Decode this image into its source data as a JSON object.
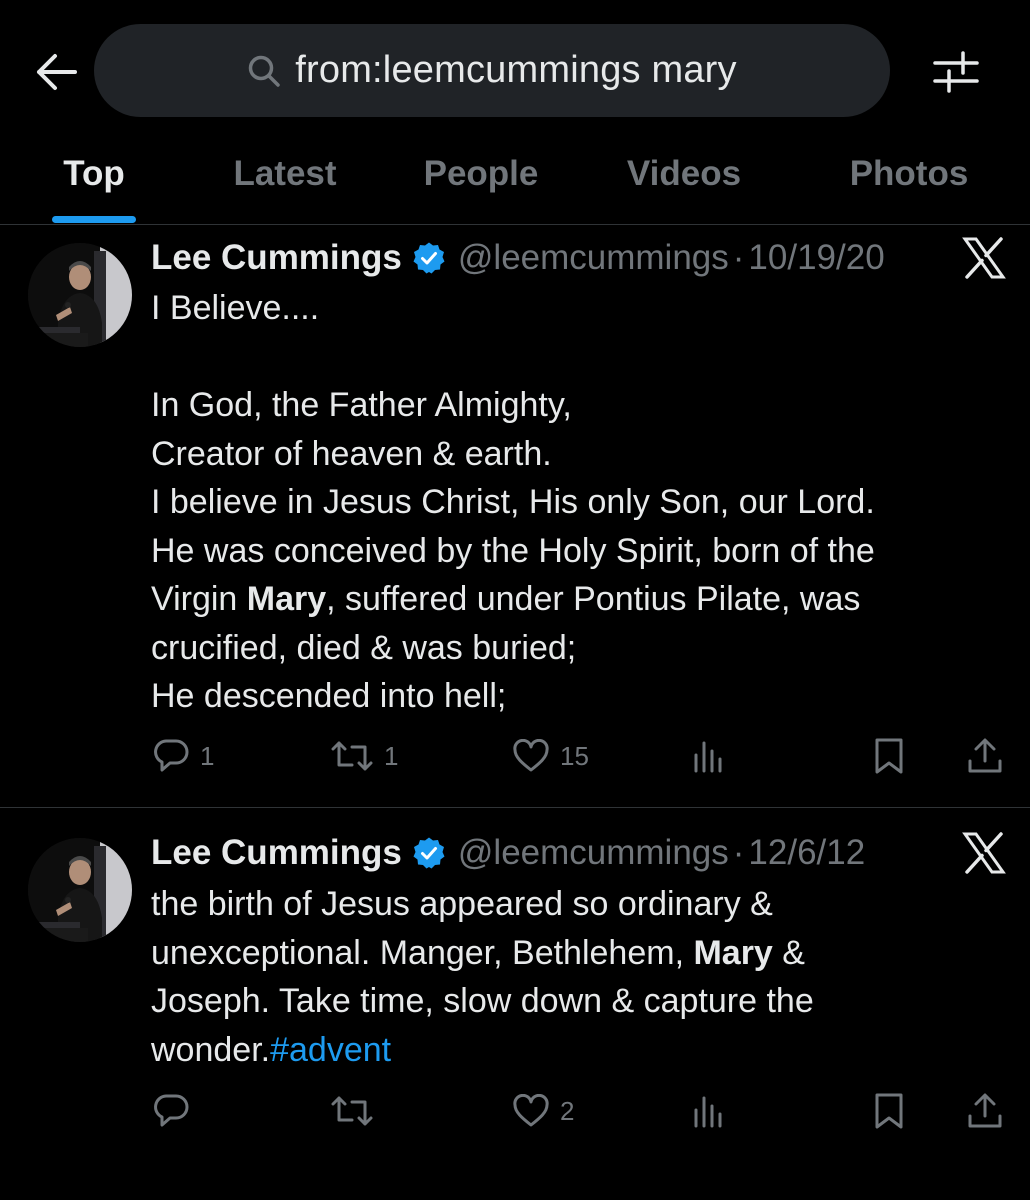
{
  "search": {
    "query": "from:leemcummings mary"
  },
  "tabs": [
    {
      "label": "Top",
      "active": true
    },
    {
      "label": "Latest",
      "active": false
    },
    {
      "label": "People",
      "active": false
    },
    {
      "label": "Videos",
      "active": false
    },
    {
      "label": "Photos",
      "active": false
    }
  ],
  "colors": {
    "background": "#000000",
    "accent": "#1d9bf0",
    "muted": "#71767b",
    "text": "#e7e9ea",
    "search_bg": "#202327"
  },
  "tweets": [
    {
      "author": "Lee Cummings",
      "handle": "@leemcummings",
      "separator": "·",
      "date": "10/19/20",
      "body": [
        {
          "text": "I Believe....\n\nIn God, the Father Almighty,\nCreator of heaven & earth.\nI believe in Jesus Christ, His only Son, our Lord.\nHe was conceived by the Holy Spirit, born of the\nVirgin "
        },
        {
          "text": "Mary",
          "style": "bold"
        },
        {
          "text": ", suffered under Pontius Pilate, was\ncrucified, died & was buried;\nHe descended into hell;"
        }
      ],
      "replies": "1",
      "reposts": "1",
      "likes": "15",
      "icons": [
        "reply-icon",
        "repost-icon",
        "like-icon",
        "views-icon",
        "bookmark-icon",
        "share-icon"
      ]
    },
    {
      "author": "Lee Cummings",
      "handle": "@leemcummings",
      "separator": "·",
      "date": "12/6/12",
      "body": [
        {
          "text": "the birth of Jesus appeared so ordinary &\nunexceptional. Manger, Bethlehem, "
        },
        {
          "text": "Mary",
          "style": "bold"
        },
        {
          "text": " &\nJoseph. Take time, slow down & capture the\nwonder."
        },
        {
          "text": "#advent",
          "style": "hashtag"
        }
      ],
      "replies": "",
      "reposts": "",
      "likes": "2",
      "icons": [
        "reply-icon",
        "repost-icon",
        "like-icon",
        "views-icon",
        "bookmark-icon",
        "share-icon"
      ]
    }
  ]
}
